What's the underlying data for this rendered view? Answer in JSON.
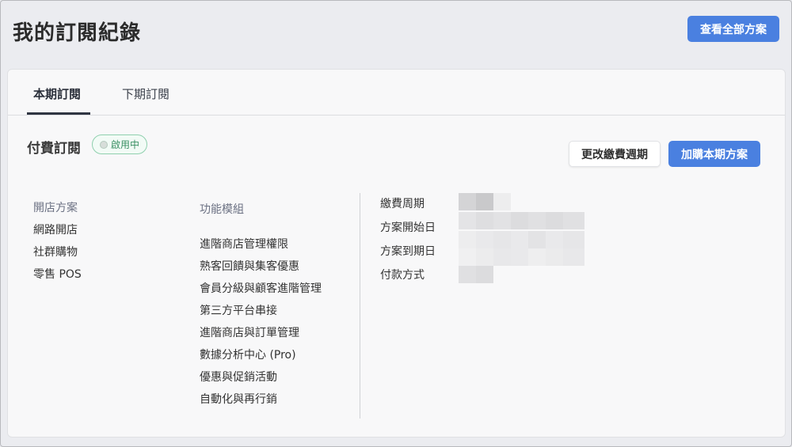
{
  "header": {
    "title": "我的訂閱紀錄",
    "view_all_label": "查看全部方案"
  },
  "tabs": [
    {
      "label": "本期訂閱",
      "active": true
    },
    {
      "label": "下期訂閱",
      "active": false
    }
  ],
  "subscription": {
    "title": "付費訂閱",
    "status": "啟用中",
    "change_cycle_label": "更改繳費週期",
    "add_plan_label": "加購本期方案"
  },
  "store_plan": {
    "heading": "開店方案",
    "items": [
      "網路開店",
      "社群購物",
      "零售 POS"
    ]
  },
  "modules": {
    "heading": "功能模組",
    "items": [
      "進階商店管理權限",
      "熟客回饋與集客優惠",
      "會員分級與顧客進階管理",
      "第三方平台串接",
      "進階商店與訂單管理",
      "數據分析中心 (Pro)",
      "優惠與促銷活動",
      "自動化與再行銷"
    ]
  },
  "details": {
    "labels": [
      "繳費周期",
      "方案開始日",
      "方案到期日",
      "付款方式"
    ]
  },
  "colors": {
    "primary": "#4a80e0",
    "status_green": "#3a8f63",
    "heading_gray": "#6b7183"
  }
}
